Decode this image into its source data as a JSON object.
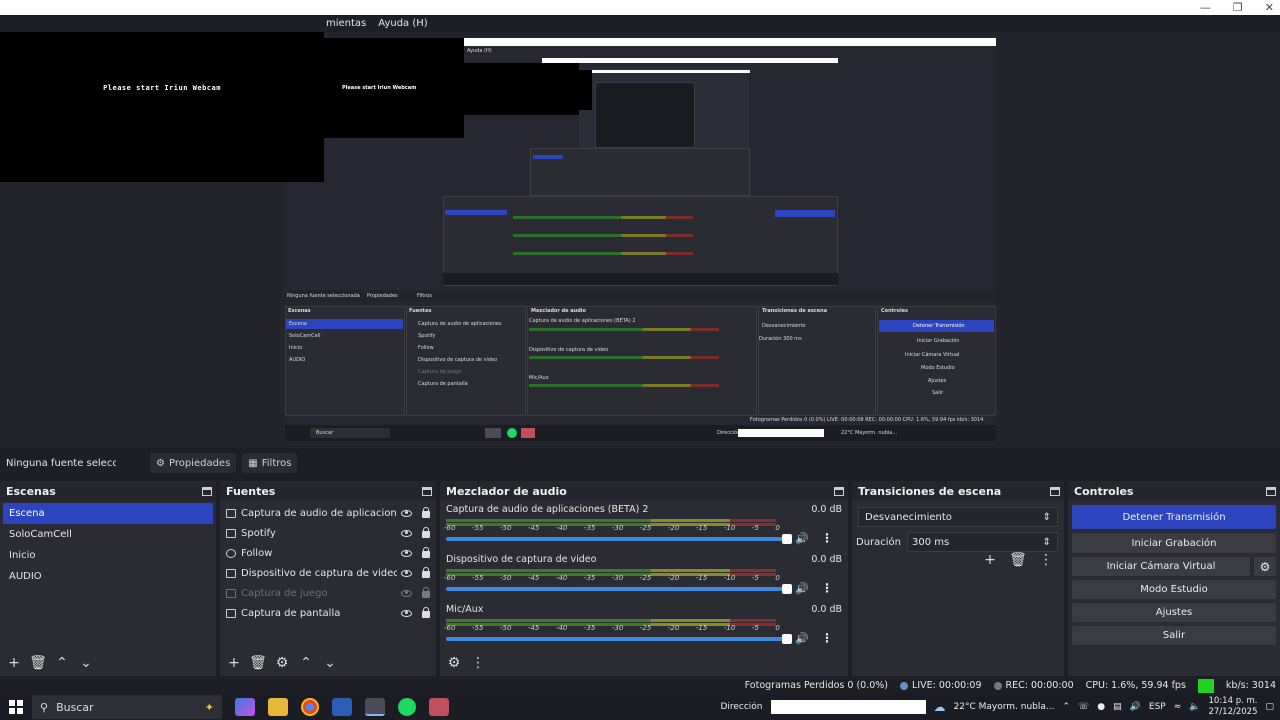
{
  "menu": {
    "items": [
      "mientas",
      "Ayuda (H)"
    ]
  },
  "preview": {
    "webcam_text": "Please start Iriun Webcam",
    "nested_webcam_text": "Please start Iriun Webcam"
  },
  "infobar": {
    "no_source": "Ninguna fuente seleccionad",
    "properties": "Propiedades",
    "filters": "Filtros"
  },
  "scenes": {
    "title": "Escenas",
    "items": [
      "Escena",
      "SoloCamCell",
      "Inicio",
      "AUDIO"
    ],
    "selected": "Escena"
  },
  "sources": {
    "title": "Fuentes",
    "items": [
      {
        "name": "Captura de audio de aplicaciones (BETA)",
        "icon": "app-audio-icon",
        "visible": true
      },
      {
        "name": "Spotify",
        "icon": "window-capture-icon",
        "visible": true
      },
      {
        "name": "Follow",
        "icon": "browser-icon",
        "visible": true
      },
      {
        "name": "Dispositivo de captura de video",
        "icon": "camera-icon",
        "visible": true
      },
      {
        "name": "Captura de juego",
        "icon": "gamepad-icon",
        "visible": false
      },
      {
        "name": "Captura de pantalla",
        "icon": "monitor-icon",
        "visible": true
      }
    ]
  },
  "mixer": {
    "title": "Mezclador de audio",
    "scale": [
      "-60",
      "-55",
      "-50",
      "-45",
      "-40",
      "-35",
      "-30",
      "-25",
      "-20",
      "-15",
      "-10",
      "-5",
      "0"
    ],
    "channels": [
      {
        "name": "Captura de audio de aplicaciones (BETA) 2",
        "db": "0.0 dB"
      },
      {
        "name": "Dispositivo de captura de video",
        "db": "0.0 dB"
      },
      {
        "name": "Mic/Aux",
        "db": "0.0 dB"
      }
    ]
  },
  "transitions": {
    "title": "Transiciones de escena",
    "selected": "Desvanecimiento",
    "duration_label": "Duración",
    "duration_value": "300 ms"
  },
  "controls": {
    "title": "Controles",
    "stop_stream": "Detener Transmisión",
    "start_recording": "Iniciar Grabación",
    "start_virtual_cam": "Iniciar Cámara Virtual",
    "studio_mode": "Modo Estudio",
    "settings": "Ajustes",
    "exit": "Salir"
  },
  "stats": {
    "dropped": "Fotogramas Perdidos 0 (0.0%)",
    "live": "LIVE: 00:00:09",
    "rec": "REC: 00:00:00",
    "cpu": "CPU: 1.6%, 59.94 fps",
    "bitrate": "kb/s: 3014"
  },
  "taskbar": {
    "search_placeholder": "Buscar",
    "address_label": "Dirección",
    "weather": "22°C  Mayorm. nubla...",
    "lang": "ESP",
    "time": "10:14 p. m.",
    "date": "27/12/2025"
  },
  "colors": {
    "accent": "#2c44bd",
    "bg": "#1e1f26",
    "panel": "#2b2c33",
    "live_indicator": "#1fd31f"
  }
}
